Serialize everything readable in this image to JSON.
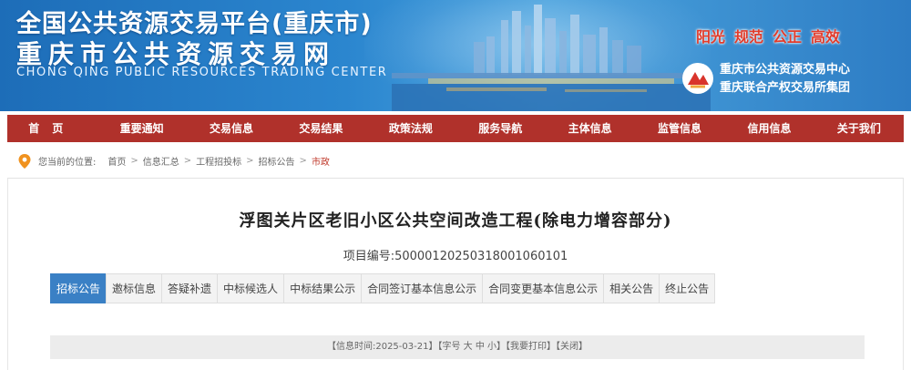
{
  "banner": {
    "title_cn": "全国公共资源交易平台(重庆市)",
    "site_name": "重庆市公共资源交易网",
    "title_en": "CHONG QING PUBLIC RESOURCES TRADING CENTER",
    "slogans": [
      "阳光",
      "规范",
      "公正",
      "高效"
    ],
    "org_lines": [
      "重庆市公共资源交易中心",
      "重庆联合产权交易所集团"
    ]
  },
  "nav": {
    "items": [
      "首页",
      "重要通知",
      "交易信息",
      "交易结果",
      "政策法规",
      "服务导航",
      "主体信息",
      "监管信息",
      "信用信息",
      "关于我们"
    ]
  },
  "breadcrumb": {
    "prefix": "您当前的位置:",
    "items": [
      "首页",
      "信息汇总",
      "工程招投标",
      "招标公告",
      "市政"
    ],
    "separator": ">"
  },
  "document": {
    "title": "浮图关片区老旧小区公共空间改造工程(除电力增容部分)",
    "project_label": "项目编号:",
    "project_no": "500001202503180010601​01"
  },
  "tabs": {
    "items": [
      "招标公告",
      "邀标信息",
      "答疑补遗",
      "中标候选人",
      "中标结果公示",
      "合同签订基本信息公示",
      "合同变更基本信息公示",
      "相关公告",
      "终止公告"
    ],
    "active_index": 0
  },
  "info_bar": {
    "time_label": "【信息时间:",
    "time_value": "2025-03-21",
    "font_label": "】【字号",
    "font_large": "大",
    "font_medium": "中",
    "font_small": "小",
    "print": "】【我要打印】",
    "close": "【关闭】"
  },
  "colors": {
    "nav_bg": "#b0312b",
    "tab_active": "#3a80c5",
    "slogan": "#e23b2a",
    "breadcrumb_current": "#c0392b"
  }
}
